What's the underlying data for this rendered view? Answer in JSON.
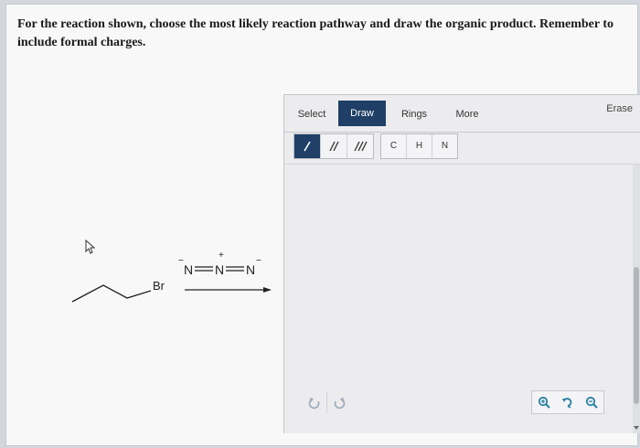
{
  "question": {
    "text": "For the reaction shown, choose the most likely reaction pathway and draw the organic product. Remember to include formal charges."
  },
  "scheme": {
    "leaving_group": "Br",
    "reagent": {
      "atom1": "N",
      "atom2": "N",
      "atom3": "N",
      "atom1_charge": "−",
      "atom2_charge": "+",
      "atom3_charge": "−"
    }
  },
  "toolbar": {
    "tabs": [
      "Select",
      "Draw",
      "Rings",
      "More"
    ],
    "active_tab": "Draw",
    "erase_label": "Erase",
    "bond_tools": [
      "single-bond",
      "double-bond",
      "triple-bond"
    ],
    "atom_tools": [
      "C",
      "H",
      "N"
    ]
  },
  "colors": {
    "accent": "#1f3f66",
    "zoom_icon": "#2a7fa0",
    "undo_icon": "#9aa9b8"
  },
  "icons": [
    "undo-icon",
    "redo-icon",
    "zoom-in-icon",
    "reset-zoom-icon",
    "zoom-out-icon",
    "cursor-icon"
  ]
}
